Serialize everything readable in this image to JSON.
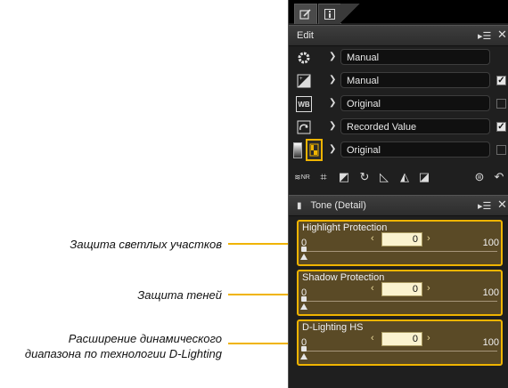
{
  "annotations": [
    {
      "text": "Защита светлых участков"
    },
    {
      "text": "Защита теней"
    },
    {
      "text": "Расширение динамического",
      "text2": "диапазона по технологии D-Lighting"
    }
  ],
  "panel": {
    "edit_header": "Edit",
    "rows": [
      {
        "icon": "gear-icon",
        "value": "Manual",
        "checkbox": null
      },
      {
        "icon": "exposure-icon",
        "value": "Manual",
        "checkbox": true
      },
      {
        "icon": "white-balance-icon",
        "value": "Original",
        "checkbox": false
      },
      {
        "icon": "picture-control-icon",
        "value": "Recorded Value",
        "checkbox": true
      },
      {
        "icon": "tone-detail-icon",
        "value": "Original",
        "checkbox": false
      }
    ],
    "wb_label": "WB",
    "tone_header": "Tone (Detail)",
    "sliders": [
      {
        "title": "Highlight Protection",
        "min": "0",
        "max": "100",
        "value": "0"
      },
      {
        "title": "Shadow Protection",
        "min": "0",
        "max": "100",
        "value": "0"
      },
      {
        "title": "D-Lighting HS",
        "min": "0",
        "max": "100",
        "value": "0"
      }
    ],
    "colors": {
      "accent": "#f0b400",
      "panel_bg": "#1f1f1f",
      "slider_bg": "#5a4a26"
    }
  }
}
